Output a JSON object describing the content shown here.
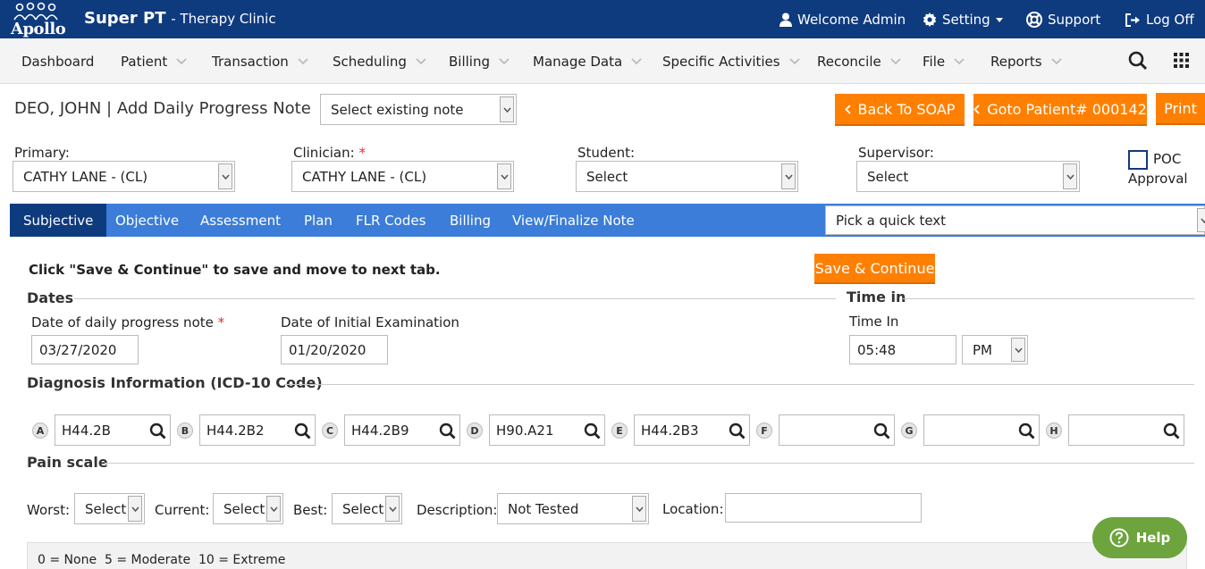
{
  "header": {
    "brand": "Super PT",
    "subtitle": "- Therapy Clinic",
    "logo_text": "Apollo",
    "welcome": "Welcome Admin",
    "setting": "Setting",
    "support": "Support",
    "logoff": "Log Off",
    "color": "#0e3a7e"
  },
  "nav": {
    "items": [
      "Dashboard",
      "Patient",
      "Transaction",
      "Scheduling",
      "Billing",
      "Manage Data",
      "Specific Activities",
      "Reconcile",
      "File",
      "Reports"
    ]
  },
  "page": {
    "title": "DEO, JOHN | Add Daily Progress Note",
    "existing_note": "Select existing note",
    "back_to_soap": "Back To SOAP",
    "goto_patient": "Goto Patient# 000142",
    "print": "Print",
    "accent": "#ff8000"
  },
  "staff": {
    "primary_label": "Primary:",
    "primary_value": "CATHY LANE - (CL)",
    "clinician_label": "Clinician:",
    "clinician_value": "CATHY LANE - (CL)",
    "student_label": "Student:",
    "student_value": "Select",
    "supervisor_label": "Supervisor:",
    "supervisor_value": "Select",
    "poc_label_1": "POC",
    "poc_label_2": "Approval",
    "required_mark": "*"
  },
  "tabs": [
    "Subjective",
    "Objective",
    "Assessment",
    "Plan",
    "FLR Codes",
    "Billing",
    "View/Finalize Note"
  ],
  "quick_text": "Pick a quick text",
  "form": {
    "instruction": "Click \"Save & Continue\" to save and move to next tab.",
    "save_continue": "Save & Continue",
    "dates_title": "Dates",
    "daily_date_label": "Date of daily progress note",
    "daily_date_value": "03/27/2020",
    "initial_date_label": "Date of Initial Examination",
    "initial_date_value": "01/20/2020",
    "time_title": "Time in",
    "time_label": "Time In",
    "time_value": "05:48",
    "ampm": "PM",
    "diagnosis_title": "Diagnosis Information (ICD-10 Code)",
    "diagnoses": [
      {
        "letter": "A",
        "code": "H44.2B"
      },
      {
        "letter": "B",
        "code": "H44.2B2"
      },
      {
        "letter": "C",
        "code": "H44.2B9"
      },
      {
        "letter": "D",
        "code": "H90.A21"
      },
      {
        "letter": "E",
        "code": "H44.2B3"
      },
      {
        "letter": "F",
        "code": ""
      },
      {
        "letter": "G",
        "code": ""
      },
      {
        "letter": "H",
        "code": ""
      }
    ],
    "pain_title": "Pain scale",
    "worst_label": "Worst:",
    "worst_value": "Select",
    "current_label": "Current:",
    "current_value": "Select",
    "best_label": "Best:",
    "best_value": "Select",
    "description_label": "Description:",
    "description_value": "Not Tested",
    "location_label": "Location:",
    "location_value": "",
    "scale_legend": "0 = None  5 = Moderate  10 = Extreme",
    "help": "Help"
  }
}
